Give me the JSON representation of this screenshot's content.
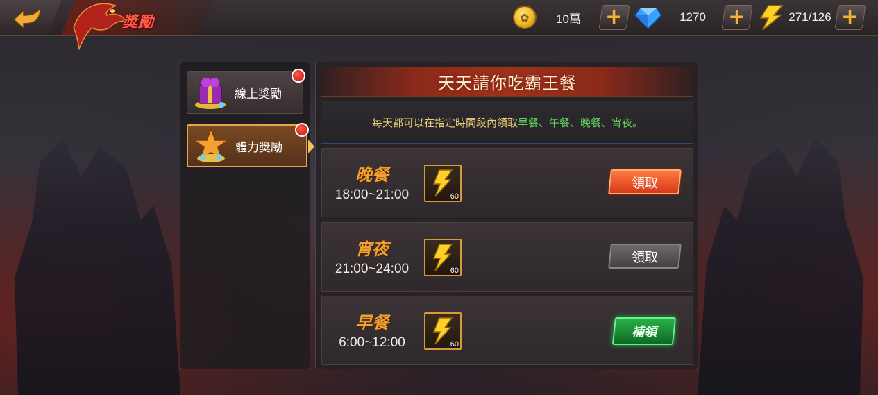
{
  "header": {
    "title": "獎勵",
    "resources": [
      {
        "name": "gold",
        "icon": "gold-coin-icon",
        "value": "10萬"
      },
      {
        "name": "diamond",
        "icon": "diamond-icon",
        "value": "1270"
      },
      {
        "name": "stamina",
        "icon": "lightning-icon",
        "value": "271/126"
      }
    ],
    "plus_label": "+"
  },
  "tabs": [
    {
      "label": "線上獎勵",
      "icon": "gift-box-icon",
      "has_notification": true,
      "selected": false
    },
    {
      "label": "體力獎勵",
      "icon": "star-treasure-icon",
      "has_notification": true,
      "selected": true
    }
  ],
  "panel": {
    "title": "天天請你吃霸王餐",
    "description_prefix": "每天都可以在指定時間段內領取",
    "description_meals": "早餐、午餐、晚餐、宵夜。"
  },
  "meals": [
    {
      "name": "晚餐",
      "time": "18:00~21:00",
      "reward_qty": "60",
      "button": "領取",
      "state": "active"
    },
    {
      "name": "宵夜",
      "time": "21:00~24:00",
      "reward_qty": "60",
      "button": "領取",
      "state": "disabled"
    },
    {
      "name": "早餐",
      "time": "6:00~12:00",
      "reward_qty": "60",
      "button": "補領",
      "state": "makeup"
    }
  ],
  "colors": {
    "accent_orange": "#f3a030",
    "claim_active": "#d7381a",
    "claim_makeup": "#1a9a3a",
    "meal_highlight": "#5fd35a",
    "notification_red": "#c0120a"
  }
}
